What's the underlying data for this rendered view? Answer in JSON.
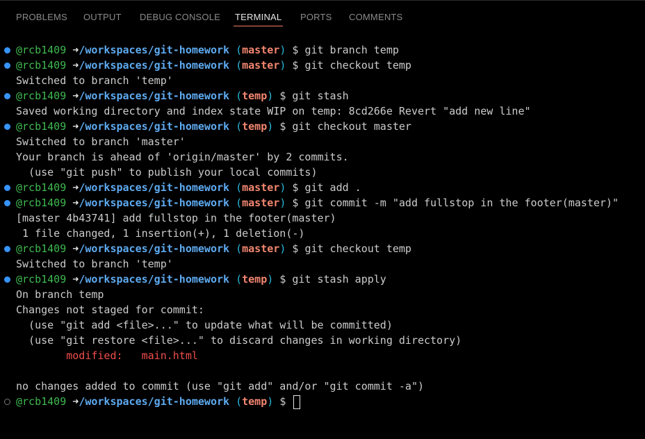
{
  "tabs": [
    {
      "label": "PROBLEMS",
      "active": false
    },
    {
      "label": "OUTPUT",
      "active": false
    },
    {
      "label": "DEBUG CONSOLE",
      "active": false
    },
    {
      "label": "TERMINAL",
      "active": true
    },
    {
      "label": "PORTS",
      "active": false
    },
    {
      "label": "COMMENTS",
      "active": false
    }
  ],
  "prompt": {
    "user": "@rcb1409",
    "arrow": "➜",
    "path": "/workspaces/git-homework",
    "dollar": "$"
  },
  "colors": {
    "user": "#3fb950",
    "path": "#5eaaf0",
    "branch": "#f48771",
    "modified": "#f14c4c",
    "tab_underline": "#f9826c"
  },
  "lines": [
    {
      "type": "prompt",
      "branch": "master",
      "cmd": "git branch temp"
    },
    {
      "type": "prompt",
      "branch": "master",
      "cmd": "git checkout temp"
    },
    {
      "type": "out",
      "text": "Switched to branch 'temp'"
    },
    {
      "type": "prompt",
      "branch": "temp",
      "cmd": "git stash"
    },
    {
      "type": "out",
      "text": "Saved working directory and index state WIP on temp: 8cd266e Revert \"add new line\""
    },
    {
      "type": "prompt",
      "branch": "temp",
      "cmd": "git checkout master"
    },
    {
      "type": "out",
      "text": "Switched to branch 'master'"
    },
    {
      "type": "out",
      "text": "Your branch is ahead of 'origin/master' by 2 commits."
    },
    {
      "type": "out",
      "text": "  (use \"git push\" to publish your local commits)"
    },
    {
      "type": "prompt",
      "branch": "master",
      "cmd": "git add ."
    },
    {
      "type": "prompt",
      "branch": "master",
      "cmd": "git commit -m \"add fullstop in the footer(master)\""
    },
    {
      "type": "out",
      "text": "[master 4b43741] add fullstop in the footer(master)"
    },
    {
      "type": "out",
      "text": " 1 file changed, 1 insertion(+), 1 deletion(-)"
    },
    {
      "type": "prompt",
      "branch": "master",
      "cmd": "git checkout temp"
    },
    {
      "type": "out",
      "text": "Switched to branch 'temp'"
    },
    {
      "type": "prompt",
      "branch": "temp",
      "cmd": "git stash apply"
    },
    {
      "type": "out",
      "text": "On branch temp"
    },
    {
      "type": "out",
      "text": "Changes not staged for commit:"
    },
    {
      "type": "out",
      "text": "  (use \"git add <file>...\" to update what will be committed)"
    },
    {
      "type": "out",
      "text": "  (use \"git restore <file>...\" to discard changes in working directory)"
    },
    {
      "type": "modified",
      "text": "        modified:   main.html"
    },
    {
      "type": "out",
      "text": ""
    },
    {
      "type": "out",
      "text": "no changes added to commit (use \"git add\" and/or \"git commit -a\")"
    },
    {
      "type": "prompt",
      "branch": "temp",
      "cmd": "",
      "current": true
    }
  ]
}
